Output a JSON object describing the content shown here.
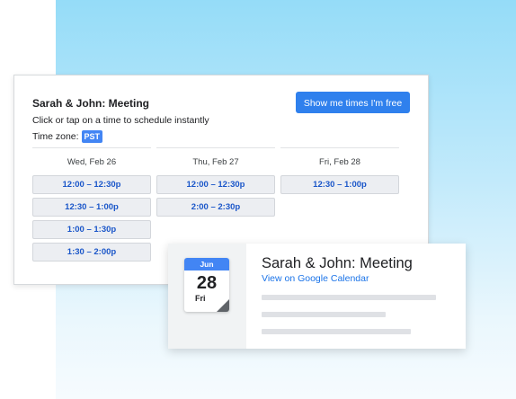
{
  "colors": {
    "accent": "#2f80ed",
    "timezone_badge": "#4285f4",
    "slot_text": "#1a56c9",
    "slot_background": "#eceef2",
    "link": "#1a73e8",
    "background_gradient_top": "#95dcf8"
  },
  "scheduler": {
    "title": "Sarah & John: Meeting",
    "instructions": "Click or tap on a time to schedule instantly",
    "timezone_label": "Time zone:",
    "timezone_value": "PST",
    "free_button_label": "Show me times I'm free",
    "days": [
      {
        "label": "Wed, Feb 26",
        "slots": [
          "12:00 – 12:30p",
          "12:30 – 1:00p",
          "1:00 – 1:30p",
          "1:30 – 2:00p"
        ]
      },
      {
        "label": "Thu, Feb 27",
        "slots": [
          "12:00 – 12:30p",
          "2:00 – 2:30p"
        ]
      },
      {
        "label": "Fri, Feb 28",
        "slots": [
          "12:30 – 1:00p"
        ]
      }
    ]
  },
  "event": {
    "calendar_icon": {
      "month": "Jun",
      "day": "28",
      "weekday": "Fri",
      "icon": "calendar-icon"
    },
    "title": "Sarah & John: Meeting",
    "link_text": "View on Google Calendar"
  }
}
